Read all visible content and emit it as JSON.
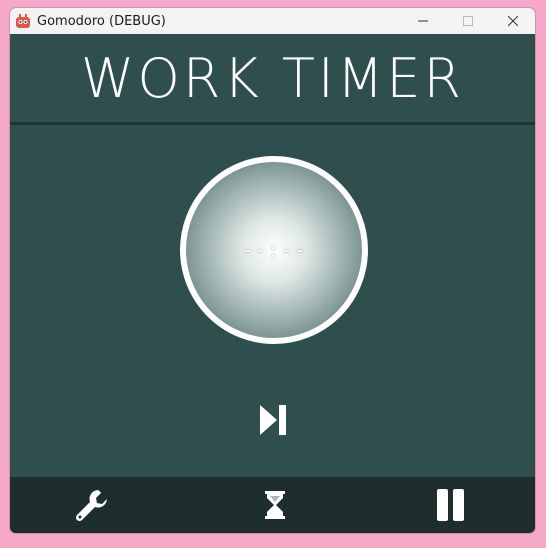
{
  "window": {
    "title": "Gomodoro (DEBUG)",
    "controls": {
      "minimize": "minimize-icon",
      "maximize": "maximize-icon",
      "close": "close-icon"
    }
  },
  "header": {
    "title": "WORK TIMER"
  },
  "timer": {
    "display": "--:--"
  },
  "controls": {
    "skip": "skip-next-icon"
  },
  "bottom_bar": {
    "settings": "wrench-icon",
    "mode": "hourglass-icon",
    "pause": "pause-icon"
  },
  "colors": {
    "background": "#2f4f4f",
    "bottom_bar": "#1e2e2e",
    "accent": "#ffffff"
  }
}
